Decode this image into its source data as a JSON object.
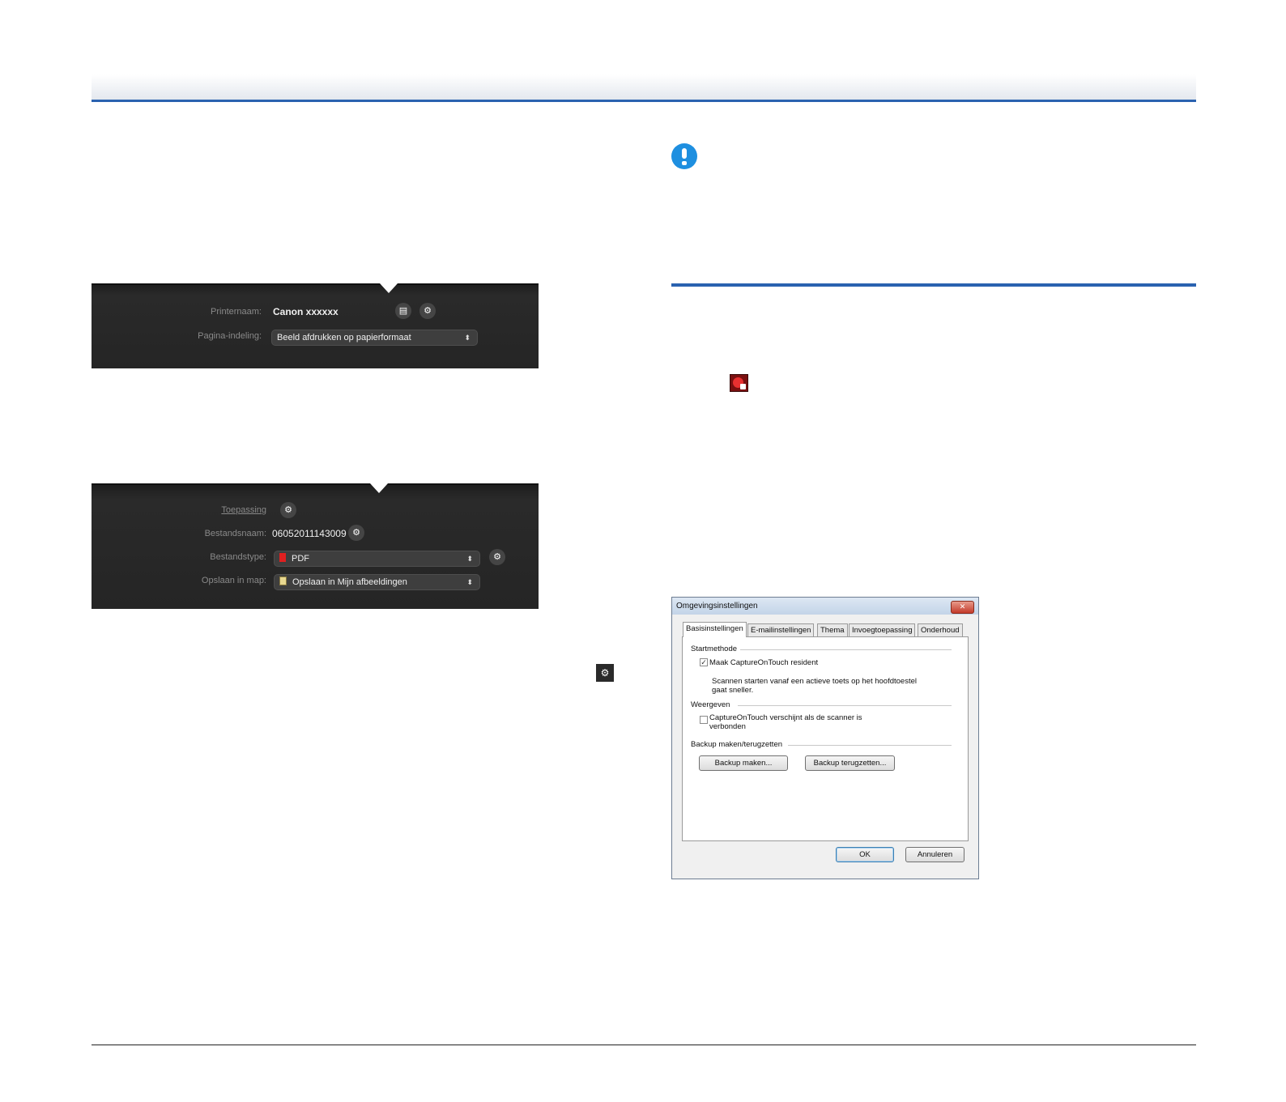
{
  "printer_panel": {
    "printer_label": "Printernaam:",
    "printer_value": "Canon xxxxxx",
    "layout_label": "Pagina-indeling:",
    "layout_value": "Beeld afdrukken op papierformaat"
  },
  "save_panel": {
    "application_label": "Toepassing",
    "filename_label": "Bestandsnaam:",
    "filename_value": "06052011143009",
    "filetype_label": "Bestandstype:",
    "filetype_value": "PDF",
    "folder_label": "Opslaan in map:",
    "folder_value": "Opslaan in Mijn afbeeldingen"
  },
  "icons": {
    "gear": "⚙",
    "doc": "▤",
    "select_arrows": "⬍",
    "close": "✕",
    "check": "✓"
  },
  "dialog": {
    "title": "Omgevingsinstellingen",
    "tabs": [
      "Basisinstellingen",
      "E-mailinstellingen",
      "Thema",
      "Invoegtoepassing",
      "Onderhoud"
    ],
    "start_group": "Startmethode",
    "resident_checkbox": "Maak CaptureOnTouch resident",
    "resident_note_line1": "Scannen starten vanaf een actieve toets op het hoofdtoestel",
    "resident_note_line2": "gaat sneller.",
    "display_group": "Weergeven",
    "display_checkbox_line1": "CaptureOnTouch verschijnt als de scanner is",
    "display_checkbox_line2": "verbonden",
    "backup_group": "Backup maken/terugzetten",
    "backup_button": "Backup maken...",
    "restore_button": "Backup terugzetten...",
    "ok_button": "OK",
    "cancel_button": "Annuleren"
  },
  "colors": {
    "accent_blue": "#2a62b0",
    "important_icon": "#1e8fe0",
    "panel_dark": "#252525"
  }
}
